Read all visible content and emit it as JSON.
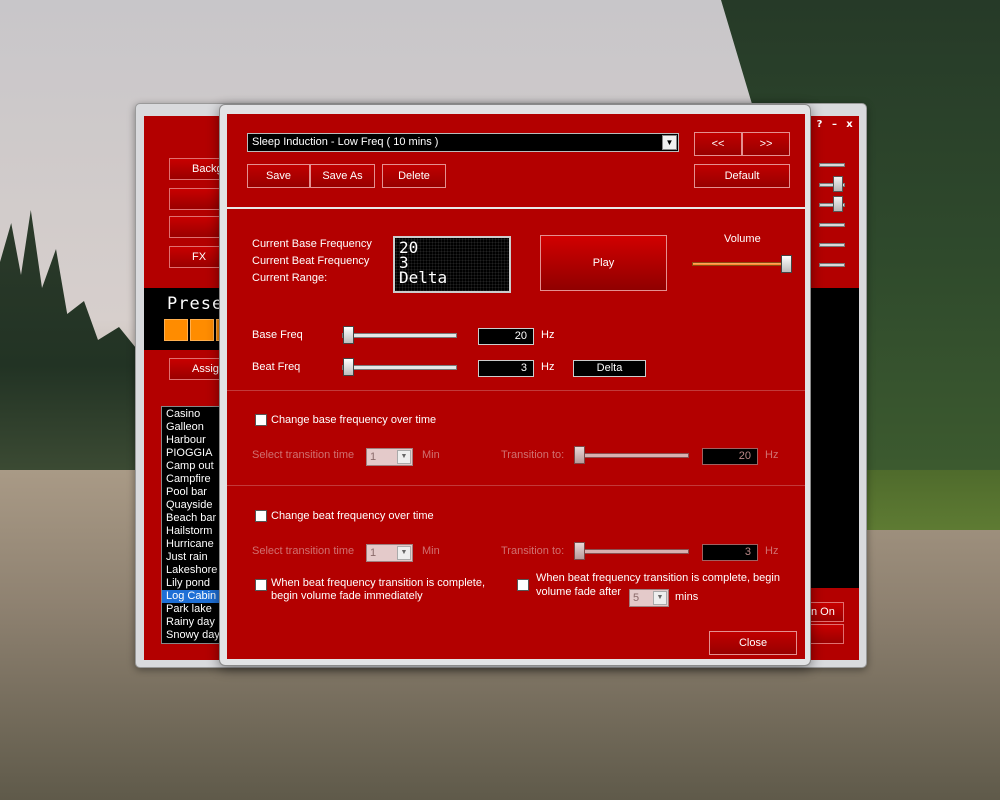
{
  "back_window": {
    "controls": [
      "?",
      "–",
      "x"
    ],
    "buttons": [
      "Backgro",
      "",
      "",
      "FX"
    ],
    "preset_title": "Prese",
    "assign_label": "Assign",
    "sound_list": [
      "Casino",
      "Galleon",
      "Harbour",
      "PIOGGIA",
      "Camp out",
      "Campfire",
      "Pool bar",
      "Quayside",
      "Beach bar",
      "Hailstorm",
      "Hurricane",
      "Just rain",
      "Lakeshore",
      "Lily pond",
      "Log Cabin",
      "Park lake",
      "Rainy day",
      "Snowy day"
    ],
    "selected_sound": "Log Cabin",
    "right_buttons": [
      "n On",
      ""
    ]
  },
  "dialog": {
    "preset": {
      "selected": "Sleep Induction - Low Freq ( 10 mins )",
      "prev_label": "<<",
      "next_label": ">>",
      "save_label": "Save",
      "save_as_label": "Save As",
      "delete_label": "Delete",
      "default_label": "Default"
    },
    "current": {
      "base_label": "Current Base Frequency",
      "beat_label": "Current Beat Frequency",
      "range_label": "Current Range:",
      "base_value": "20",
      "beat_value": "3",
      "range_value": "Delta"
    },
    "play_label": "Play",
    "volume": {
      "label": "Volume",
      "level": 0.95
    },
    "base_freq": {
      "label": "Base Freq",
      "value": "20",
      "unit": "Hz",
      "level": 0.0
    },
    "beat_freq": {
      "label": "Beat Freq",
      "value": "3",
      "unit": "Hz",
      "range": "Delta",
      "level": 0.0
    },
    "base_transition": {
      "checkbox_label": "Change base frequency over time",
      "checked": false,
      "time_label": "Select transition time",
      "time_value": "1",
      "time_unit": "Min",
      "to_label": "Transition to:",
      "to_value": "20",
      "to_unit": "Hz"
    },
    "beat_transition": {
      "checkbox_label": "Change beat frequency over time",
      "checked": false,
      "time_label": "Select transition time",
      "time_value": "1",
      "time_unit": "Min",
      "to_label": "Transition to:",
      "to_value": "3",
      "to_unit": "Hz"
    },
    "fade_immediate": {
      "line1": "When beat frequency transition is complete,",
      "line2": "begin volume fade immediately",
      "checked": false
    },
    "fade_after": {
      "line1": "When beat frequency transition is complete, begin",
      "line2": "volume fade after",
      "value": "5",
      "unit": "mins",
      "checked": false
    },
    "close_label": "Close"
  }
}
